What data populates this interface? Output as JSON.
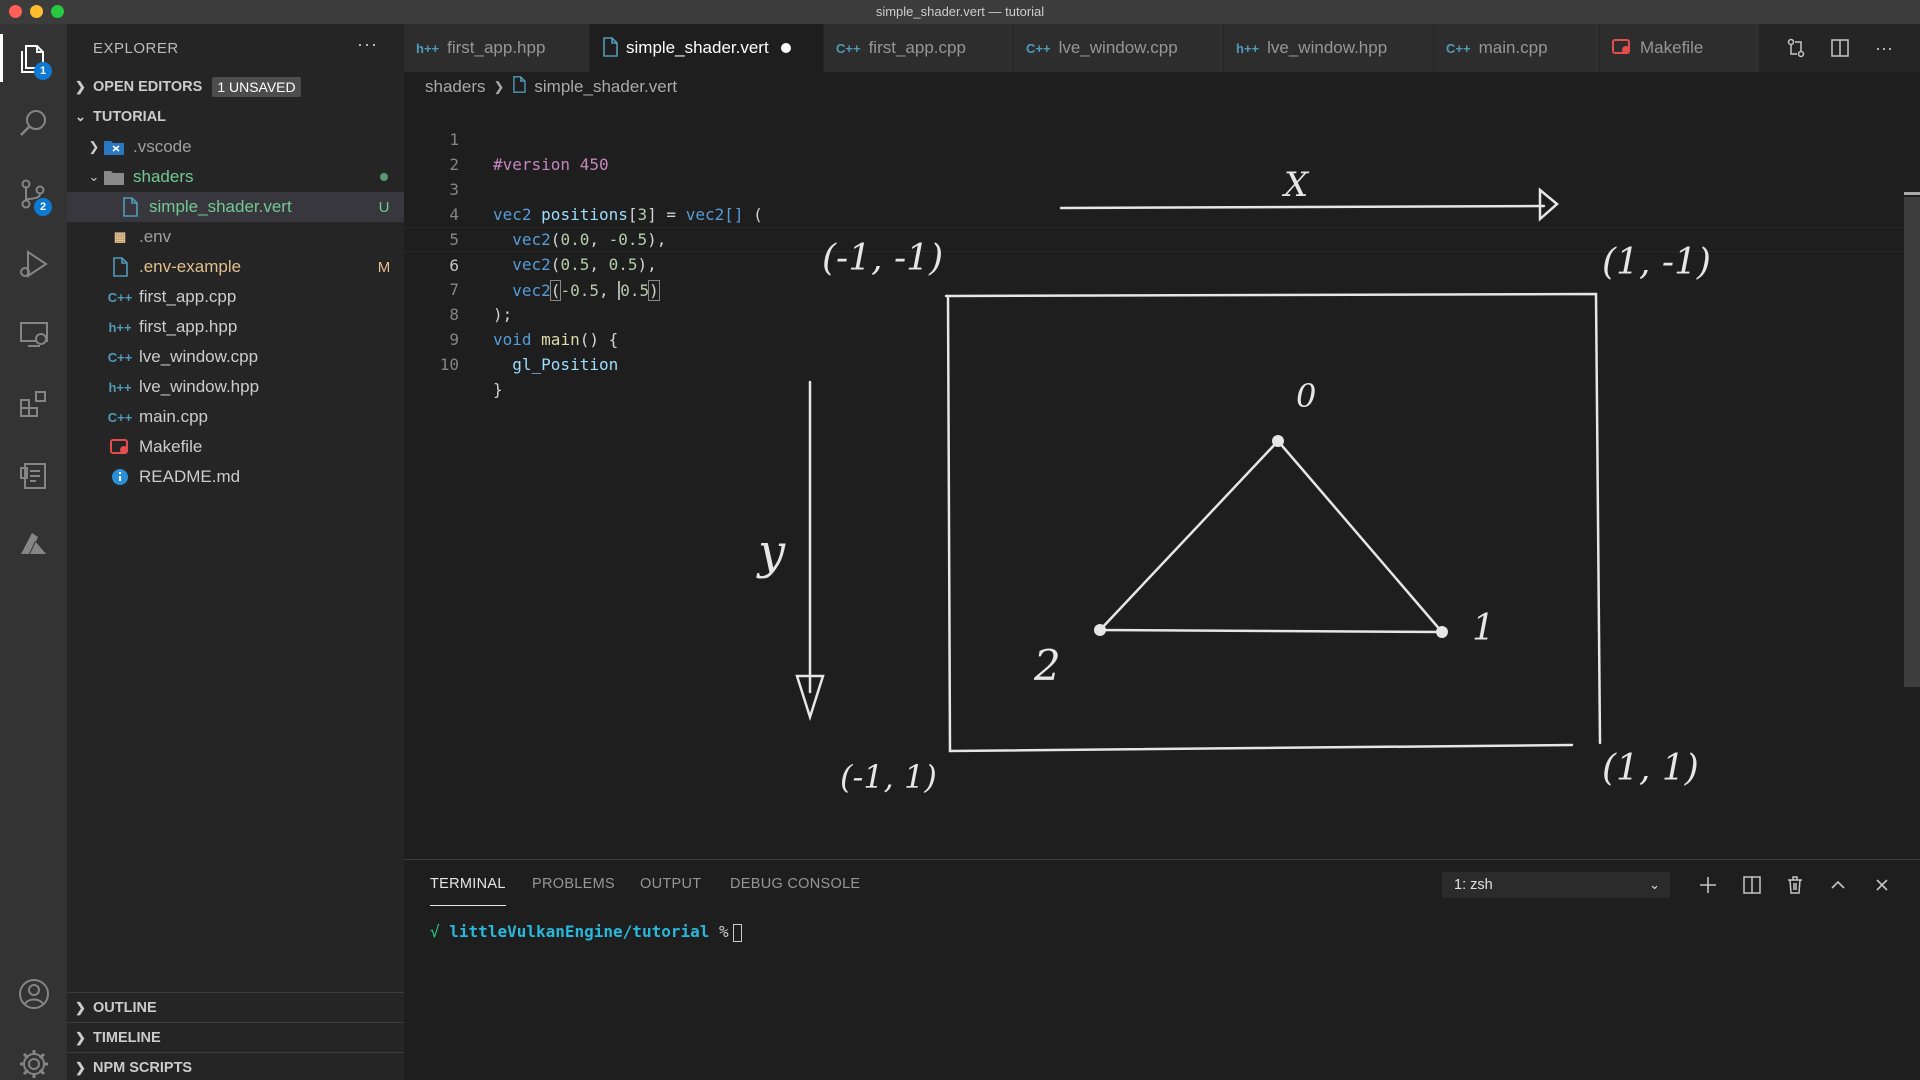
{
  "window": {
    "title": "simple_shader.vert — tutorial"
  },
  "activity_bar": {
    "explorer_badge": "1",
    "scm_badge": "2",
    "items": [
      "explorer",
      "search",
      "source-control",
      "run-debug",
      "remote-explorer",
      "extensions",
      "task-runner",
      "azure",
      "accounts",
      "manage"
    ]
  },
  "sidebar": {
    "title": "EXPLORER",
    "more": "···",
    "open_editors": {
      "label": "OPEN EDITORS",
      "badge": "1 UNSAVED"
    },
    "folder": {
      "label": "TUTORIAL"
    },
    "tree": [
      {
        "name": ".vscode",
        "type": "folder",
        "icon": "vscode-folder-icon",
        "status": ""
      },
      {
        "name": "shaders",
        "type": "folder-open",
        "icon": "folder-icon",
        "status": "dot"
      },
      {
        "name": "simple_shader.vert",
        "type": "file",
        "icon": "file-icon",
        "status": "U"
      },
      {
        "name": ".env",
        "type": "file",
        "icon": "env-icon",
        "status": ""
      },
      {
        "name": ".env-example",
        "type": "file",
        "icon": "file-icon",
        "status": "M"
      },
      {
        "name": "first_app.cpp",
        "type": "file",
        "icon": "cpp-icon",
        "status": ""
      },
      {
        "name": "first_app.hpp",
        "type": "file",
        "icon": "hpp-icon",
        "status": ""
      },
      {
        "name": "lve_window.cpp",
        "type": "file",
        "icon": "cpp-icon",
        "status": ""
      },
      {
        "name": "lve_window.hpp",
        "type": "file",
        "icon": "hpp-icon",
        "status": ""
      },
      {
        "name": "main.cpp",
        "type": "file",
        "icon": "cpp-icon",
        "status": ""
      },
      {
        "name": "Makefile",
        "type": "file",
        "icon": "makefile-icon",
        "status": ""
      },
      {
        "name": "README.md",
        "type": "file",
        "icon": "info-icon",
        "status": ""
      }
    ],
    "outline": "OUTLINE",
    "timeline": "TIMELINE",
    "npm_scripts": "NPM SCRIPTS"
  },
  "tabs": [
    {
      "label": "first_app.hpp",
      "icon": "h++"
    },
    {
      "label": "simple_shader.vert",
      "icon": "file",
      "active": true,
      "dirty": true
    },
    {
      "label": "first_app.cpp",
      "icon": "C++"
    },
    {
      "label": "lve_window.cpp",
      "icon": "C++"
    },
    {
      "label": "lve_window.hpp",
      "icon": "h++"
    },
    {
      "label": "main.cpp",
      "icon": "C++"
    },
    {
      "label": "Makefile",
      "icon": "makefile"
    }
  ],
  "icon_glyphs": {
    "cpp": "C++",
    "hpp": "h++"
  },
  "breadcrumb": {
    "folder": "shaders",
    "file": "simple_shader.vert"
  },
  "editor": {
    "line_numbers": [
      "1",
      "2",
      "3",
      "4",
      "5",
      "6",
      "7",
      "8",
      "9",
      "10"
    ],
    "lines": [
      "#version 450",
      "",
      "vec2 positions[3] = vec2[] (",
      "  vec2(0.0, -0.5),",
      "  vec2(0.5, 0.5),",
      "  vec2(-0.5, 0.5)",
      ");",
      "void main() {",
      "  gl_Position",
      "}"
    ],
    "current_line": 6
  },
  "sketch": {
    "x_axis_label": "X",
    "y_axis_label": "y",
    "corners": {
      "top_left": "(-1, -1)",
      "top_right": "(1, -1)",
      "bottom_left": "(-1, 1)",
      "bottom_right": "(1, 1)"
    },
    "vertex_labels": [
      "0",
      "1",
      "2"
    ]
  },
  "panel": {
    "tabs": [
      "TERMINAL",
      "PROBLEMS",
      "OUTPUT",
      "DEBUG CONSOLE"
    ],
    "active_tab": "TERMINAL",
    "terminal_select": "1: zsh",
    "prompt_check": "√",
    "prompt_path": "littleVulkanEngine/tutorial",
    "prompt_symbol": "%"
  },
  "colors": {
    "accent": "#0e7ad3",
    "untracked": "#73c991",
    "modified": "#e2c08d",
    "cpp_icon": "#519aba",
    "makefile_icon": "#e44d4d"
  }
}
